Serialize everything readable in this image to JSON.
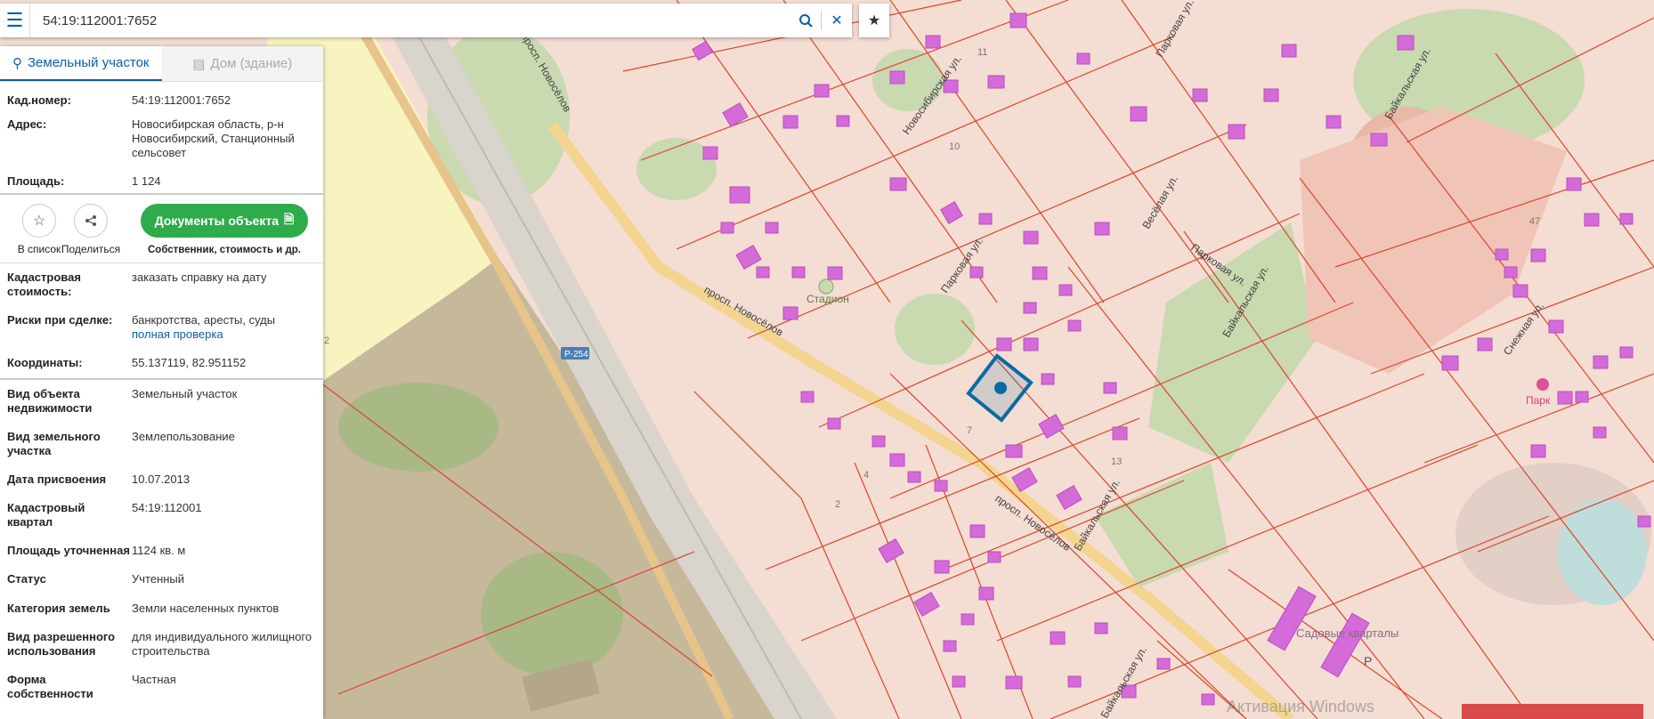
{
  "search": {
    "value": "54:19:112001:7652"
  },
  "icons": {
    "menu": "hamburger-icon",
    "search": "search-icon",
    "clear": "close-icon",
    "favorite": "star-icon",
    "share": "share-icon",
    "pin": "map-pin-icon",
    "building": "building-icon",
    "document": "document-icon"
  },
  "tabs": [
    {
      "label": "Земельный участок",
      "active": true
    },
    {
      "label": "Дом (здание)",
      "active": false
    }
  ],
  "info_top": [
    {
      "label": "Кад.номер:",
      "value": "54:19:112001:7652",
      "link": true
    },
    {
      "label": "Адрес:",
      "value": "Новосибирская область, р-н Новосибирский, Станционный сельсовет",
      "link": false
    },
    {
      "label": "Площадь:",
      "value": "1 124",
      "link": false
    }
  ],
  "actions": {
    "to_list": "В список",
    "share": "Поделиться",
    "documents": "Документы объекта",
    "documents_sub": "Собственник, стоимость и др."
  },
  "info_mid": [
    {
      "label": "Кадастровая стоимость:",
      "value": "заказать справку на дату",
      "link": true
    },
    {
      "label": "Риски при сделке:",
      "value": "банкротства, аресты, суды",
      "extra": "полная проверка"
    },
    {
      "label": "Координаты:",
      "value": "55.137119, 82.951152",
      "link": false
    }
  ],
  "info_bottom": [
    {
      "label": "Вид объекта недвижимости",
      "value": "Земельный участок"
    },
    {
      "label": "Вид земельного участка",
      "value": "Землепользование"
    },
    {
      "label": "Дата присвоения",
      "value": "10.07.2013"
    },
    {
      "label": "Кадастровый квартал",
      "value": "54:19:112001"
    },
    {
      "label": "Площадь уточненная",
      "value": "1124 кв. м"
    },
    {
      "label": "Статус",
      "value": "Учтенный"
    },
    {
      "label": "Категория земель",
      "value": "Земли населенных пунктов"
    },
    {
      "label": "Вид разрешенного использования",
      "value": "для индивидуального жилищного строительства"
    },
    {
      "label": "Форма собственности",
      "value": "Частная"
    }
  ],
  "map": {
    "street_labels": [
      "просп. Новосёлов",
      "просп. Новосёлов",
      "просп. Новосёлов",
      "Новосибирская ул.",
      "Парковая ул.",
      "Парковая ул.",
      "Парковая ул.",
      "Весёлая ул.",
      "Байкальская ул.",
      "Байкальская ул.",
      "Байкальская ул.",
      "Байкальская ул.",
      "Снежная ул."
    ],
    "poi": {
      "stadium": "Стадион",
      "park": "Парк",
      "sadovye": "Садовые кварталы",
      "parking": "P",
      "road": "Р-254"
    },
    "numbers": [
      "10",
      "11",
      "47",
      "7",
      "13",
      "4",
      "2",
      "2"
    ],
    "overlay_text": "Активация Windows",
    "colors": {
      "residential": "#f4ddd2",
      "parcel_line": "#d9462f",
      "building": "#d46bd9",
      "road": "#f3d58f",
      "forest": "#c9d9b0",
      "field": "#c6b89b",
      "yellow_zone": "#f8f4c0",
      "selected": "#0b6aa4",
      "button": "#2eab4a"
    }
  }
}
